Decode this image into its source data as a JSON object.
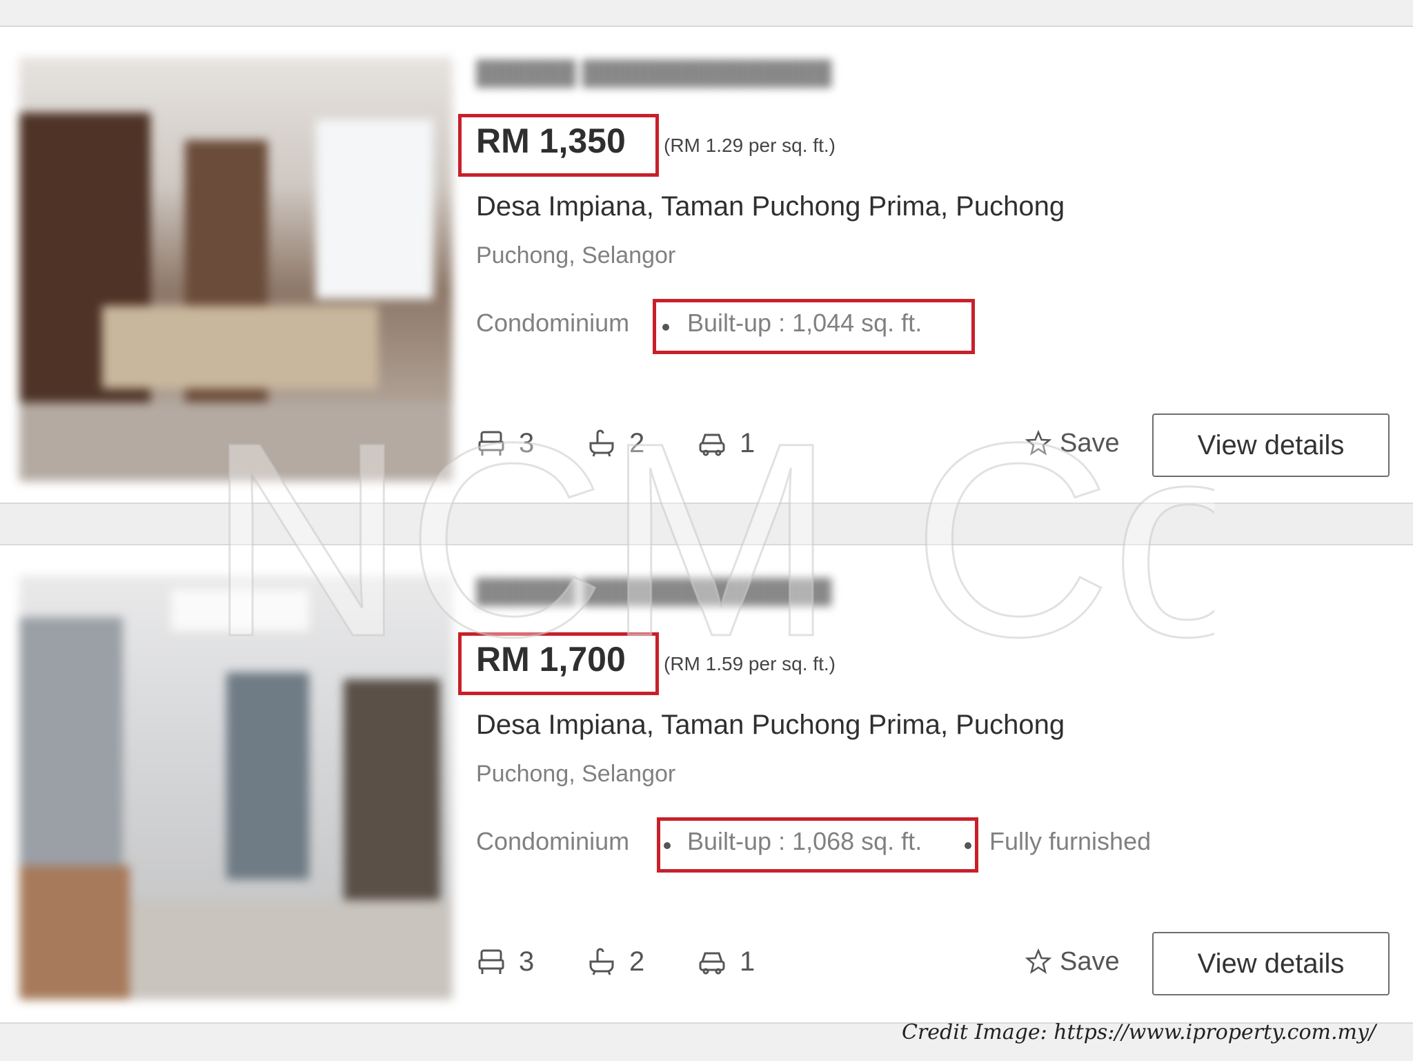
{
  "listings": [
    {
      "price": "RM 1,350",
      "per_sqft": "(RM 1.29 per sq. ft.)",
      "title": "Desa Impiana, Taman Puchong Prima, Puchong",
      "location": "Puchong, Selangor",
      "property_type": "Condominium",
      "builtup": "Built-up : 1,044 sq. ft.",
      "bedrooms": "3",
      "bathrooms": "2",
      "parking": "1",
      "save_label": "Save",
      "view_label": "View details"
    },
    {
      "price": "RM 1,700",
      "per_sqft": "(RM 1.59 per sq. ft.)",
      "title": "Desa Impiana, Taman Puchong Prima, Puchong",
      "location": "Puchong, Selangor",
      "property_type": "Condominium",
      "builtup": "Built-up : 1,068 sq. ft.",
      "furnishing": "Fully furnished",
      "bedrooms": "3",
      "bathrooms": "2",
      "parking": "1",
      "save_label": "Save",
      "view_label": "View details"
    }
  ],
  "watermark": "NCM Co",
  "credit": "Credit Image: https://www.iproperty.com.my/",
  "colors": {
    "highlight": "#c8202a",
    "text_dark": "#2f2f2f",
    "text_muted": "#808080"
  }
}
